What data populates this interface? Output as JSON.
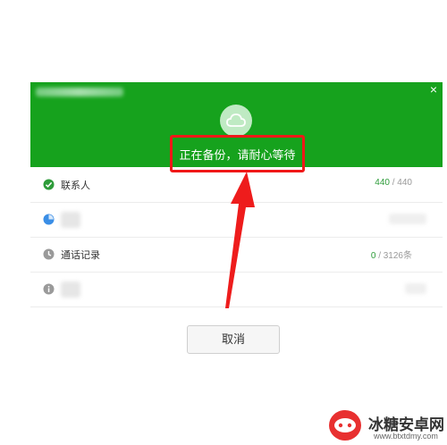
{
  "header": {
    "close_label": "×",
    "status_text": "正在备份，请耐心等待",
    "cloud_icon": "cloud-icon",
    "background_color": "#16a21d",
    "highlight_color": "#f01818"
  },
  "rows": [
    {
      "label": "联系人",
      "done": "440",
      "total": "/ 440",
      "icon": "check-circle-icon",
      "icon_color": "#2e9c3a"
    },
    {
      "label": "",
      "done": "",
      "total": "",
      "icon": "progress-circle-icon",
      "icon_color": "#3a8ee6"
    },
    {
      "label": "通话记录",
      "done": "0",
      "total": "/ 3126条",
      "icon": "clock-icon",
      "icon_color": "#999999"
    },
    {
      "label": "",
      "done": "",
      "total": "",
      "icon": "info-icon",
      "icon_color": "#999999"
    }
  ],
  "footer": {
    "cancel_label": "取消"
  },
  "watermark": {
    "title": "冰糖安卓网",
    "url": "www.btxtdmy.com"
  }
}
